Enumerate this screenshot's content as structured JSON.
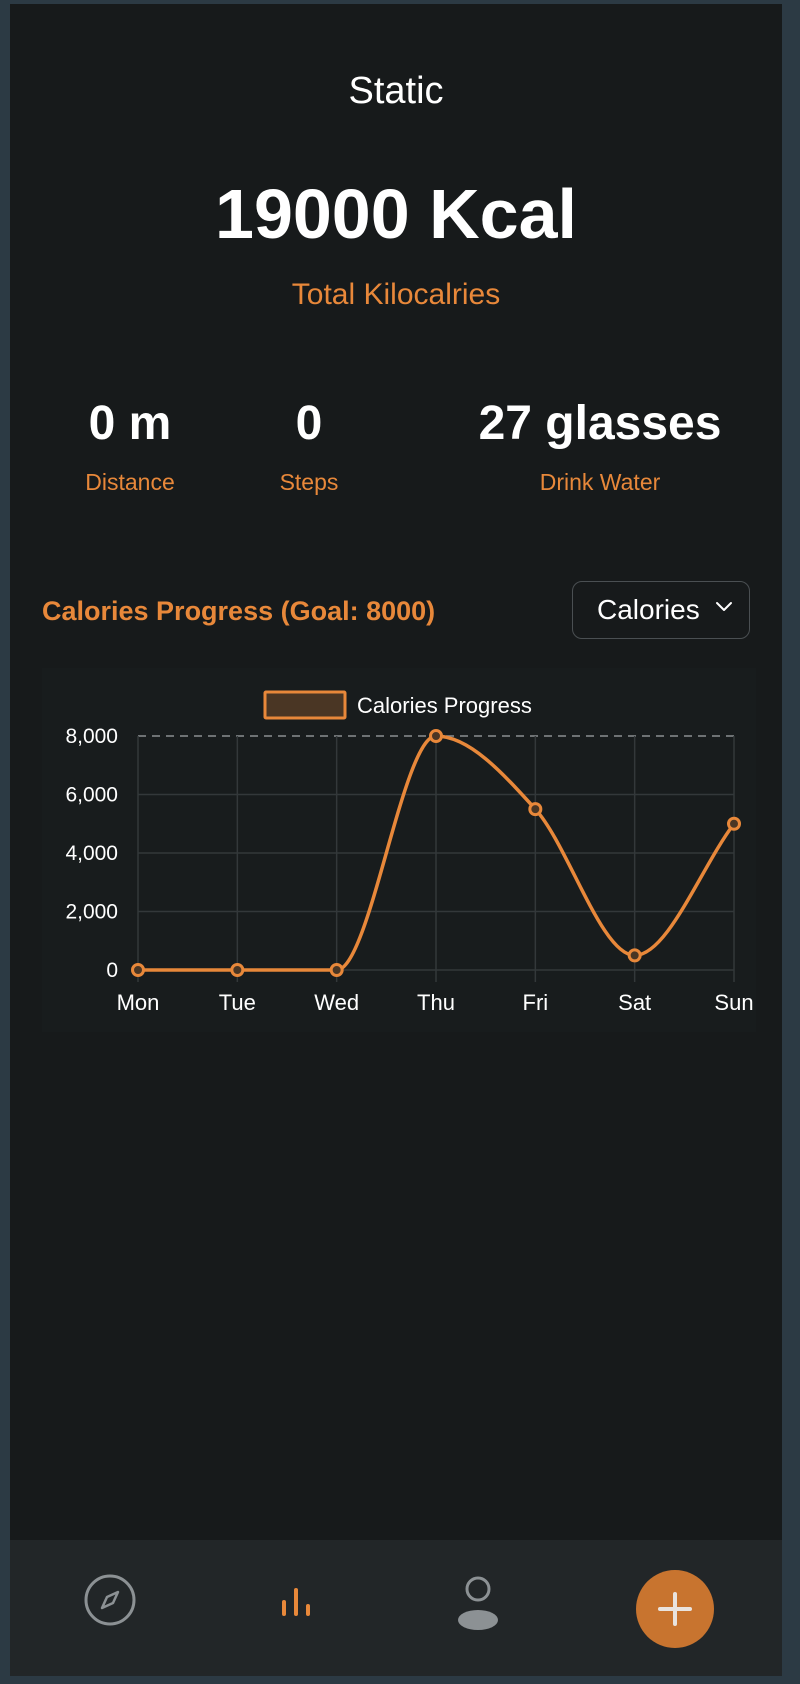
{
  "header": {
    "title": "Static"
  },
  "summary": {
    "total_value": "19000 Kcal",
    "total_label": "Total Kilocalries"
  },
  "stats": {
    "distance": {
      "value": "0 m",
      "label": "Distance"
    },
    "steps": {
      "value": "0",
      "label": "Steps"
    },
    "water": {
      "value": "27 glasses",
      "label": "Drink Water"
    }
  },
  "progress": {
    "title": "Calories Progress (Goal: 8000)",
    "selected_metric": "Calories"
  },
  "chart_data": {
    "type": "line",
    "categories": [
      "Mon",
      "Tue",
      "Wed",
      "Thu",
      "Fri",
      "Sat",
      "Sun"
    ],
    "series": [
      {
        "name": "Calories Progress",
        "values": [
          0,
          0,
          0,
          8000,
          5500,
          500,
          5000
        ]
      }
    ],
    "goal": 8000,
    "ylim": [
      0,
      8000
    ],
    "yticks": [
      {
        "value": 0,
        "label": "0"
      },
      {
        "value": 2000,
        "label": "2,000"
      },
      {
        "value": 4000,
        "label": "4,000"
      },
      {
        "value": 6000,
        "label": "6,000"
      },
      {
        "value": 8000,
        "label": "8,000"
      }
    ],
    "grid": true,
    "legend": "top-center",
    "colors": {
      "line": "#e8883a",
      "legend_fill": "#4a3624",
      "grid": "#33383a",
      "goal_line": "#8a8f92"
    }
  },
  "tabbar": {
    "tabs": [
      {
        "icon": "compass-icon",
        "active": false
      },
      {
        "icon": "bar-chart-icon",
        "active": true
      },
      {
        "icon": "user-icon",
        "active": false
      }
    ],
    "add_icon": "plus-icon",
    "accent": "#c8742f"
  }
}
